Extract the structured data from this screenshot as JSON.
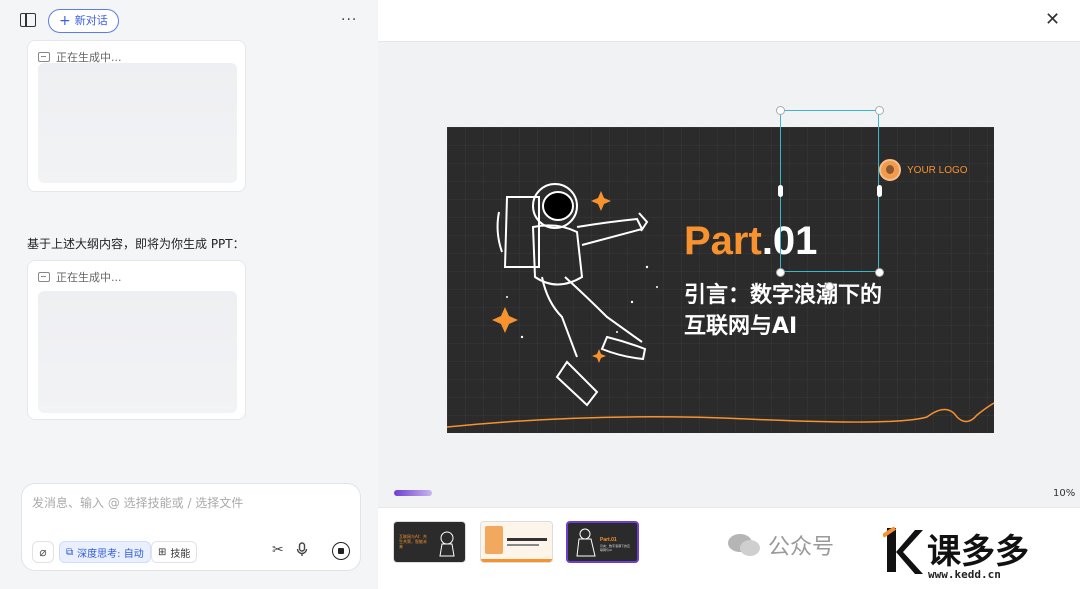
{
  "left_panel": {
    "new_chat_label": "新对话",
    "more_label": "···",
    "card1_status": "正在生成中...",
    "message": "基于上述大纲内容，即将为你生成 PPT：",
    "card2_status": "正在生成中...",
    "composer": {
      "placeholder": "发消息、输入 @ 选择技能或 / 选择文件",
      "deep_think_label": "深度思考: 自动",
      "skill_label": "技能"
    }
  },
  "right_panel": {
    "close_label": "✕",
    "slide": {
      "logo_text": "YOUR LOGO",
      "part_prefix": "Part",
      "part_number": ".01",
      "subtitle_line1": "引言：数字浪潮下的",
      "subtitle_line2": "互联网与AI"
    },
    "progress_percent": "10%",
    "progress_value": 0.1,
    "thumbnails": [
      {
        "title": "互联网与AI：共生共荣，智能未来",
        "theme": "dark"
      },
      {
        "title": "",
        "theme": "light"
      },
      {
        "title": "Part.01",
        "subtitle": "引言：数字浪潮下的互联网与AI",
        "theme": "dark",
        "selected": true
      }
    ]
  },
  "watermark": {
    "text": "公众号",
    "brand": "课多多",
    "url": "www.kedd.cn"
  },
  "colors": {
    "accent_orange": "#f7922f",
    "accent_purple": "#6d3fd0",
    "selection_cyan": "#3bb6c8",
    "brand_blue": "#3b5fe0"
  }
}
